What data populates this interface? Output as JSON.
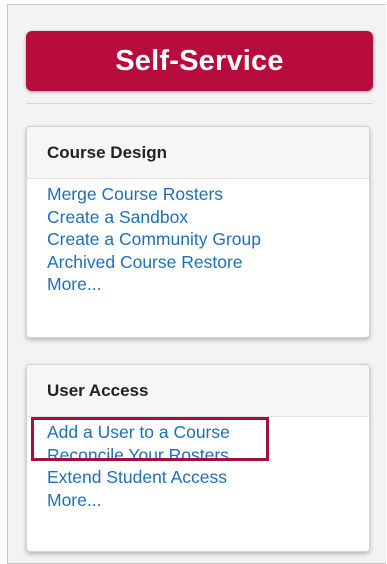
{
  "header": {
    "title": "Self-Service"
  },
  "panels": [
    {
      "heading": "Course Design",
      "links": [
        "Merge Course Rosters",
        "Create a Sandbox",
        "Create a Community Group",
        "Archived Course Restore",
        "More..."
      ]
    },
    {
      "heading": "User Access",
      "links": [
        "Add a User to a Course",
        "Reconcile Your Rosters",
        "Extend Student Access",
        "More..."
      ]
    }
  ],
  "colors": {
    "brand": "#b70c3c",
    "link": "#1f6fb8",
    "highlight": "#a50f3f"
  }
}
